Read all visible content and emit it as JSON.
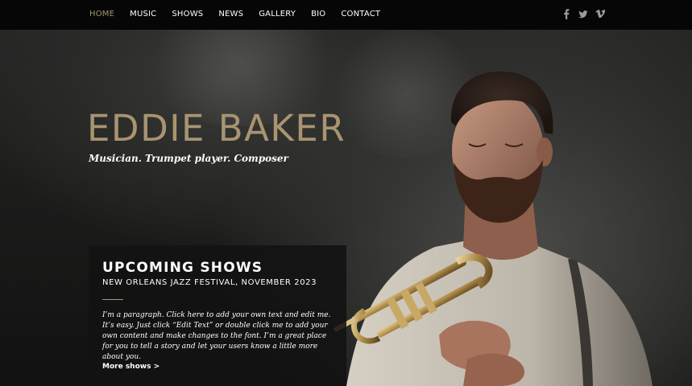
{
  "nav": {
    "items": [
      {
        "label": "HOME",
        "active": true
      },
      {
        "label": "MUSIC",
        "active": false
      },
      {
        "label": "SHOWS",
        "active": false
      },
      {
        "label": "NEWS",
        "active": false
      },
      {
        "label": "GALLERY",
        "active": false
      },
      {
        "label": "BIO",
        "active": false
      },
      {
        "label": "CONTACT",
        "active": false
      }
    ]
  },
  "social": {
    "icons": [
      "facebook-icon",
      "twitter-icon",
      "vimeo-icon"
    ]
  },
  "hero": {
    "title": "EDDIE BAKER",
    "tagline": "Musician. Trumpet player. Composer"
  },
  "upcoming": {
    "title": "UPCOMING SHOWS",
    "subtitle": "NEW ORLEANS JAZZ FESTIVAL, NOVEMBER 2023",
    "paragraph": "I’m a paragraph. Click here to add your own text and edit me. It’s easy. Just click “Edit Text” or double click me to add your own content and make changes to the font. I’m a great place for you to tell a story and let your users know a little more about you.",
    "more_label": "More shows >"
  },
  "colors": {
    "accent_gold": "#a89470",
    "nav_background": "#060606",
    "panel_background": "#121212",
    "text": "#ffffff"
  }
}
